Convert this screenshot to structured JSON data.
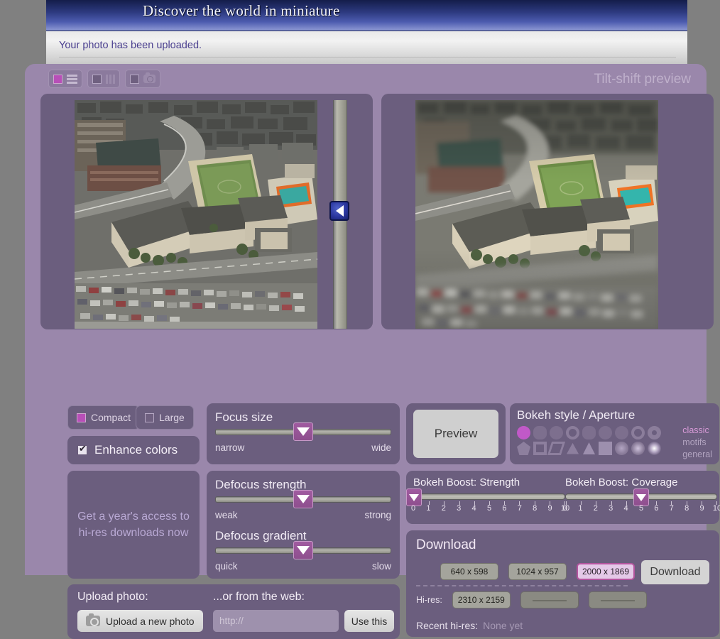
{
  "banner": {
    "title": "Discover the world in miniature",
    "notice": "Your photo has been uploaded."
  },
  "toolbar": {
    "groups": [
      {
        "name": "view-list",
        "icon": "list-icon",
        "active": true
      },
      {
        "name": "view-columns",
        "icon": "columns-icon",
        "active": false
      },
      {
        "name": "view-camera",
        "icon": "camera-icon",
        "active": false
      }
    ]
  },
  "panel": {
    "title": "Tilt-shift preview"
  },
  "images": {
    "source_alt": "aerial photo of school campus with sports field",
    "preview_alt": "tilt-shift miniature preview of school campus"
  },
  "modes": {
    "compact": "Compact",
    "large": "Large",
    "enhance": "Enhance colors"
  },
  "promo": {
    "text": "Get a year's access to hi-res downloads now"
  },
  "sliders": {
    "focus": {
      "title": "Focus size",
      "min_label": "narrow",
      "max_label": "wide",
      "value_pct": 50
    },
    "defocus_strength": {
      "title": "Defocus strength",
      "min_label": "weak",
      "max_label": "strong",
      "value_pct": 50
    },
    "defocus_gradient": {
      "title": "Defocus gradient",
      "min_label": "quick",
      "max_label": "slow",
      "value_pct": 50
    }
  },
  "preview": {
    "button_label": "Preview"
  },
  "bokeh": {
    "title": "Bokeh style / Aperture",
    "legend": [
      "classic",
      "motifs",
      "general"
    ],
    "row1": [
      "circle-filled-selected",
      "octagon",
      "circle-soft",
      "circle-ring",
      "heptagon",
      "hexagon-soft",
      "circle-solid",
      "donut-small",
      "donut-large"
    ],
    "row2": [
      "pentagon",
      "square-outline",
      "parallelogram",
      "triangle-outline",
      "triangle-filled",
      "square-filled",
      "blur-dot-large",
      "blur-dot-medium",
      "blur-dot-bright"
    ],
    "selected_index": 0
  },
  "boost": {
    "strength": {
      "title_prefix": "Bokeh Boost: ",
      "title_value": "Strength",
      "value": 0,
      "ticks": [
        "0",
        "1",
        "2",
        "3",
        "4",
        "5",
        "6",
        "7",
        "8",
        "9",
        "10"
      ]
    },
    "coverage": {
      "title_prefix": "Bokeh Boost: ",
      "title_value": "Coverage",
      "value": 5,
      "ticks": [
        "0",
        "1",
        "2",
        "3",
        "4",
        "5",
        "6",
        "7",
        "8",
        "9",
        "10"
      ]
    }
  },
  "download": {
    "title": "Download",
    "sizes": [
      {
        "label": "640 x 598",
        "selected": false,
        "disabled": false
      },
      {
        "label": "1024 x 957",
        "selected": false,
        "disabled": false
      },
      {
        "label": "2000 x 1869",
        "selected": true,
        "disabled": false
      }
    ],
    "button_label": "Download",
    "hires_label": "Hi-res:",
    "hires_sizes": [
      {
        "label": "2310 x 2159",
        "disabled": false
      },
      {
        "label": "",
        "disabled": true
      },
      {
        "label": "",
        "disabled": true
      }
    ],
    "recent_label": "Recent hi-res:",
    "recent_value": "None yet"
  },
  "upload": {
    "heading": "Upload photo:",
    "button_label": "Upload a new photo",
    "web_heading": "...or from the web:",
    "url_placeholder": "http://",
    "url_value": "",
    "use_this_label": "Use this"
  },
  "colors": {
    "accent": "#b84fb8",
    "panel": "#9a87ab",
    "card": "#6b5e7e",
    "banner_blue": "#2d3a80",
    "selected_pink": "#e4c9e8"
  }
}
